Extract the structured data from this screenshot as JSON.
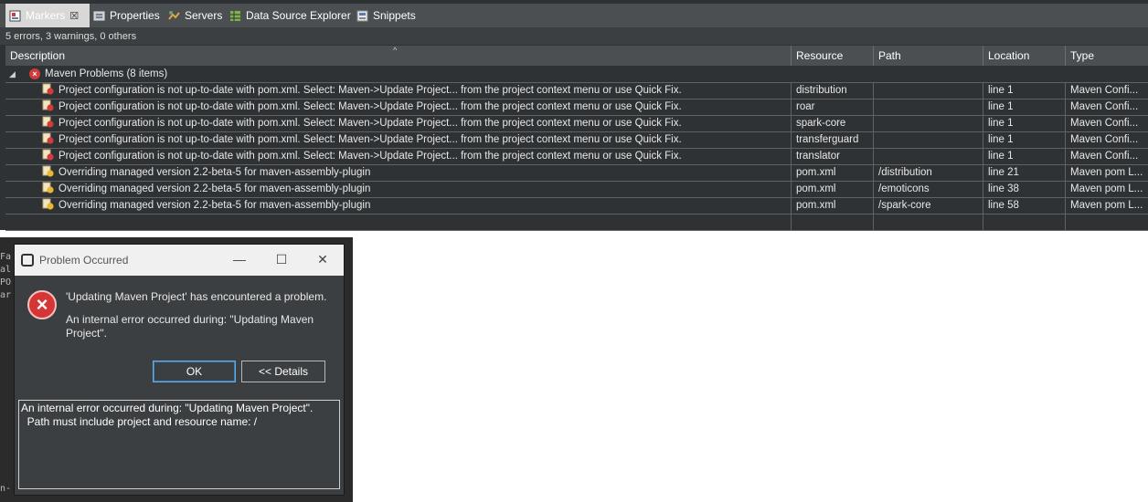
{
  "tabs": [
    {
      "label": "Markers",
      "icon": "markers-icon",
      "active": true
    },
    {
      "label": "Properties",
      "icon": "properties-icon"
    },
    {
      "label": "Servers",
      "icon": "servers-icon"
    },
    {
      "label": "Data Source Explorer",
      "icon": "data-source-explorer-icon"
    },
    {
      "label": "Snippets",
      "icon": "snippets-icon"
    }
  ],
  "status": "5 errors, 3 warnings, 0 others",
  "columns": [
    "Description",
    "Resource",
    "Path",
    "Location",
    "Type"
  ],
  "group": {
    "label": "Maven Problems (8 items)"
  },
  "rows": [
    {
      "severity": "error",
      "description": "Project configuration is not up-to-date with pom.xml. Select: Maven->Update Project... from the project context menu or use Quick Fix.",
      "resource": "distribution",
      "path": "",
      "location": "line 1",
      "type": "Maven Confi..."
    },
    {
      "severity": "error",
      "description": "Project configuration is not up-to-date with pom.xml. Select: Maven->Update Project... from the project context menu or use Quick Fix.",
      "resource": "roar",
      "path": "",
      "location": "line 1",
      "type": "Maven Confi..."
    },
    {
      "severity": "error",
      "description": "Project configuration is not up-to-date with pom.xml. Select: Maven->Update Project... from the project context menu or use Quick Fix.",
      "resource": "spark-core",
      "path": "",
      "location": "line 1",
      "type": "Maven Confi..."
    },
    {
      "severity": "error",
      "description": "Project configuration is not up-to-date with pom.xml. Select: Maven->Update Project... from the project context menu or use Quick Fix.",
      "resource": "transferguard",
      "path": "",
      "location": "line 1",
      "type": "Maven Confi..."
    },
    {
      "severity": "error",
      "description": "Project configuration is not up-to-date with pom.xml. Select: Maven->Update Project... from the project context menu or use Quick Fix.",
      "resource": "translator",
      "path": "",
      "location": "line 1",
      "type": "Maven Confi..."
    },
    {
      "severity": "warning",
      "description": "Overriding managed version 2.2-beta-5 for maven-assembly-plugin",
      "resource": "pom.xml",
      "path": "/distribution",
      "location": "line 21",
      "type": "Maven pom L..."
    },
    {
      "severity": "warning",
      "description": "Overriding managed version 2.2-beta-5 for maven-assembly-plugin",
      "resource": "pom.xml",
      "path": "/emoticons",
      "location": "line 38",
      "type": "Maven pom L..."
    },
    {
      "severity": "warning",
      "description": "Overriding managed version 2.2-beta-5 for maven-assembly-plugin",
      "resource": "pom.xml",
      "path": "/spark-core",
      "location": "line 58",
      "type": "Maven pom L..."
    }
  ],
  "background_text": [
    "Fa",
    "al",
    "PO",
    "ar",
    "n-"
  ],
  "dialog": {
    "title": "Problem Occurred",
    "message": "'Updating Maven Project' has encountered a problem.",
    "detail": "An internal error occurred during: \"Updating Maven Project\".",
    "ok_label": "OK",
    "details_label": "<< Details",
    "details_text": "An internal error occurred during: \"Updating Maven Project\".\n  Path must include project and resource name: /"
  },
  "colors": {
    "error": "#d33b3b",
    "warning": "#e8b830",
    "view_bg": "#2f3234",
    "dialog_bg": "#3c3f41"
  }
}
